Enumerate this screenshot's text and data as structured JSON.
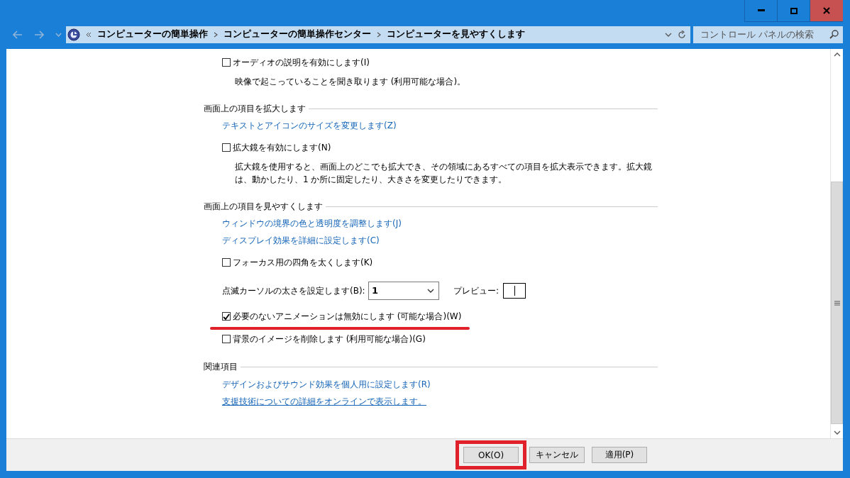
{
  "address_bar": {
    "crumbs": [
      "コンピューターの簡単操作",
      "コンピューターの簡単操作センター",
      "コンピューターを見やすくします"
    ]
  },
  "search": {
    "placeholder": "コントロール パネルの検索"
  },
  "sections": [
    {
      "items": [
        {
          "kind": "checkbox",
          "label": "オーディオの説明を有効にします(I)",
          "checked": false,
          "highlighted": false
        },
        {
          "kind": "desc",
          "text": "映像で起こっていることを聞き取ります (利用可能な場合)。"
        }
      ]
    },
    {
      "heading": "画面上の項目を拡大します",
      "items": [
        {
          "kind": "link",
          "label": "テキストとアイコンのサイズを変更します(Z)",
          "underlined": false
        },
        {
          "kind": "checkbox",
          "label": "拡大鏡を有効にします(N)",
          "checked": false,
          "highlighted": false
        },
        {
          "kind": "desc",
          "text": "拡大鏡を使用すると、画面上のどこでも拡大でき、その領域にあるすべての項目を拡大表示できます。拡大鏡は、動かしたり、1 か所に固定したり、大きさを変更したりできます。"
        }
      ]
    },
    {
      "heading": "画面上の項目を見やすくします",
      "items": [
        {
          "kind": "link",
          "label": "ウィンドウの境界の色と透明度を調整します(J)",
          "underlined": false
        },
        {
          "kind": "link",
          "label": "ディスプレイ効果を詳細に設定します(C)",
          "underlined": false
        },
        {
          "kind": "checkbox",
          "label": "フォーカス用の四角を太くします(K)",
          "checked": false,
          "highlighted": false
        },
        {
          "kind": "cursor",
          "label": "点滅カーソルの太さを設定します(B):",
          "value": "1",
          "preview_label": "プレビュー:"
        },
        {
          "kind": "checkbox",
          "label": "必要のないアニメーションは無効にします (可能な場合)(W)",
          "checked": true,
          "highlighted": true
        },
        {
          "kind": "checkbox",
          "label": "背景のイメージを削除します (利用可能な場合)(G)",
          "checked": false,
          "highlighted": false
        }
      ]
    },
    {
      "heading": "関連項目",
      "items": [
        {
          "kind": "link",
          "label": "デザインおよびサウンド効果を個人用に設定します(R)",
          "underlined": false
        },
        {
          "kind": "link",
          "label": "支援技術についての詳細をオンラインで表示します。",
          "underlined": true
        }
      ]
    }
  ],
  "buttons": [
    {
      "label": "OK(O)",
      "highlighted": true
    },
    {
      "label": "キャンセル",
      "highlighted": false
    },
    {
      "label": "適用(P)",
      "highlighted": false
    }
  ]
}
